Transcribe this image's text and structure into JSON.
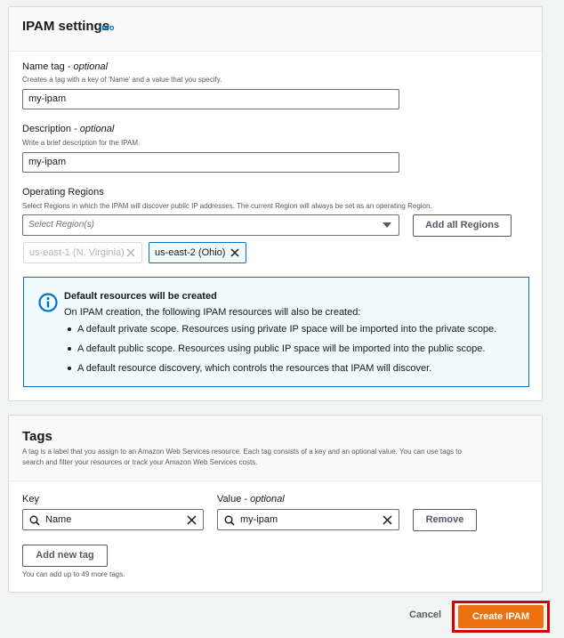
{
  "ipam_settings": {
    "title": "IPAM settings",
    "info": "Info",
    "name_tag": {
      "label": "Name tag",
      "optional": " - optional",
      "description": "Creates a tag with a key of 'Name' and a value that you specify.",
      "value": "my-ipam"
    },
    "description": {
      "label": "Description",
      "optional": " - optional",
      "description": "Write a brief description for the IPAM.",
      "value": "my-ipam"
    },
    "operating_regions": {
      "label": "Operating Regions",
      "description": "Select Regions in which the IPAM will discover public IP addresses. The current Region will always be set as an operating Region.",
      "placeholder": "Select Region(s)",
      "add_all_label": "Add all Regions",
      "tokens": [
        {
          "label": "us-east-1 (N. Virginia)",
          "state": "disabled"
        },
        {
          "label": "us-east-2 (Ohio)",
          "state": "active"
        }
      ]
    },
    "alert": {
      "title": "Default resources will be created",
      "text": "On IPAM creation, the following IPAM resources will also be created:",
      "items": [
        "A default private scope. Resources using private IP space will be imported into the private scope.",
        "A default public scope. Resources using public IP space will be imported into the public scope.",
        "A default resource discovery, which controls the resources that IPAM will discover."
      ]
    }
  },
  "tags": {
    "title": "Tags",
    "description_line1": "A tag is a label that you assign to an Amazon Web Services resource. Each tag consists of a key and an optional value. You can use tags to",
    "description_line2": "search and filter your resources or track your Amazon Web Services costs.",
    "key_label": "Key",
    "value_label": "Value",
    "value_optional": " - optional",
    "key_value": "Name",
    "value_value": "my-ipam",
    "remove_label": "Remove",
    "add_new_tag_label": "Add new tag",
    "limit_text": "You can add up to 49 more tags."
  },
  "footer": {
    "cancel_label": "Cancel",
    "create_label": "Create IPAM"
  },
  "colors": {
    "primary": "#ec7211",
    "link": "#0073bb",
    "highlight": "#d50000"
  }
}
